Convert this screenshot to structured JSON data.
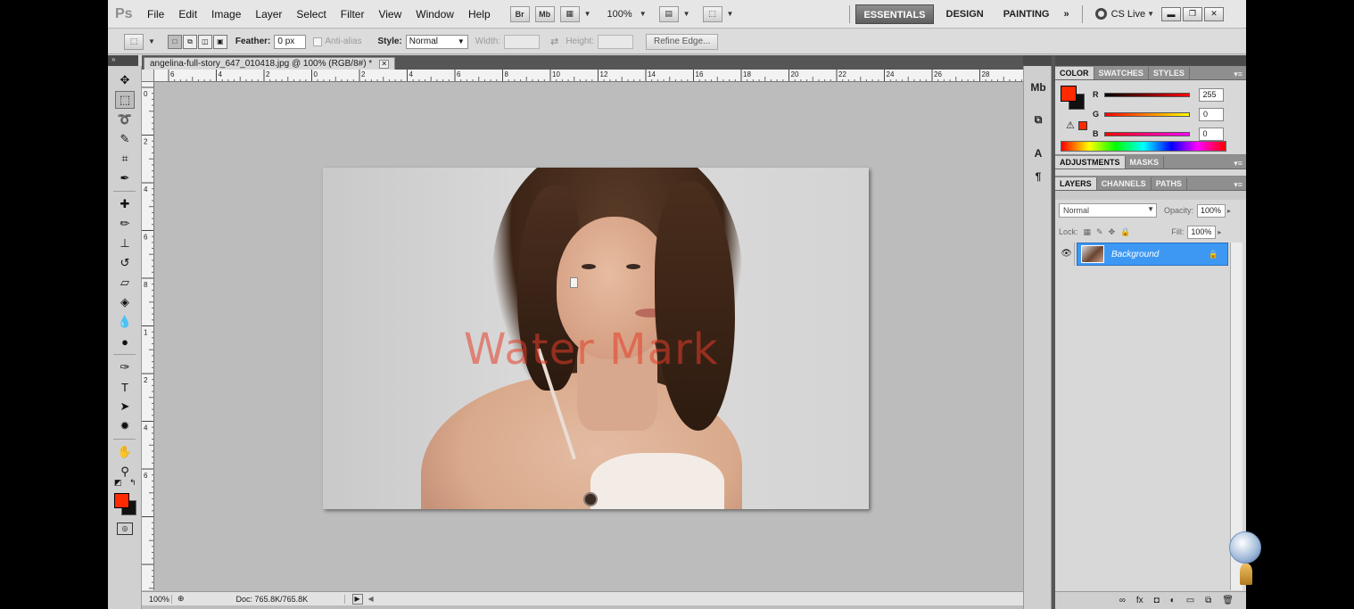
{
  "app": {
    "logo": "Ps",
    "menu": [
      "File",
      "Edit",
      "Image",
      "Layer",
      "Select",
      "Filter",
      "View",
      "Window",
      "Help"
    ],
    "bridge_btn": "Br",
    "minibridge_btn": "Mb",
    "zoom": "100%",
    "workspaces": [
      "ESSENTIALS",
      "DESIGN",
      "PAINTING"
    ],
    "more": "»",
    "cs_live": "CS Live"
  },
  "options": {
    "feather_label": "Feather:",
    "feather_value": "0 px",
    "antialias_label": "Anti-alias",
    "style_label": "Style:",
    "style_value": "Normal",
    "width_label": "Width:",
    "height_label": "Height:",
    "refine_edge": "Refine Edge..."
  },
  "document": {
    "tab_title": "angelina-full-story_647_010418.jpg @ 100% (RGB/8#) *",
    "watermark_text": "Water Mark",
    "status_zoom": "100%",
    "status_doc": "Doc: 765.8K/765.8K",
    "ruler_labels": [
      "6",
      "4",
      "2",
      "0",
      "2",
      "4",
      "6",
      "8",
      "10",
      "12",
      "14",
      "16",
      "18",
      "20",
      "22",
      "24",
      "26",
      "28"
    ],
    "vruler_labels": [
      "0",
      "2",
      "4",
      "6",
      "8",
      "1",
      "2",
      "4",
      "6"
    ]
  },
  "color_panel": {
    "tabs": [
      "COLOR",
      "SWATCHES",
      "STYLES"
    ],
    "fg_color": "#ff2a00",
    "bg_color": "#111111",
    "r_label": "R",
    "g_label": "G",
    "b_label": "B",
    "r_value": "255",
    "g_value": "0",
    "b_value": "0"
  },
  "adjust_panel": {
    "tabs": [
      "ADJUSTMENTS",
      "MASKS"
    ]
  },
  "layers_panel": {
    "tabs": [
      "LAYERS",
      "CHANNELS",
      "PATHS"
    ],
    "blend_mode": "Normal",
    "opacity_label": "Opacity:",
    "opacity_value": "100%",
    "lock_label": "Lock:",
    "fill_label": "Fill:",
    "fill_value": "100%",
    "layer_name": "Background"
  }
}
